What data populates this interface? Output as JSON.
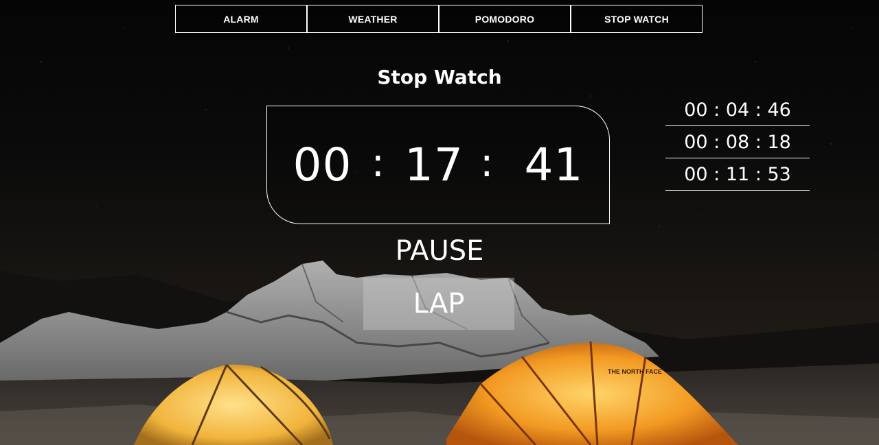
{
  "nav": {
    "items": [
      {
        "label": "ALARM"
      },
      {
        "label": "WEATHER"
      },
      {
        "label": "POMODORO"
      },
      {
        "label": "STOP WATCH"
      }
    ]
  },
  "stopwatch": {
    "title": "Stop Watch",
    "hours": "00",
    "minutes": "17",
    "seconds": "41",
    "separator": ":",
    "pause_label": "PAUSE",
    "lap_label": "LAP"
  },
  "laps": [
    {
      "time": "00 : 04 : 46"
    },
    {
      "time": "00 : 08 : 18"
    },
    {
      "time": "00 : 11 : 53"
    }
  ],
  "colors": {
    "text": "#ffffff",
    "lap_button_bg": "rgba(200,200,200,0.45)",
    "tent_orange": "#f08a1c",
    "tent_yellow": "#f5b83a"
  }
}
